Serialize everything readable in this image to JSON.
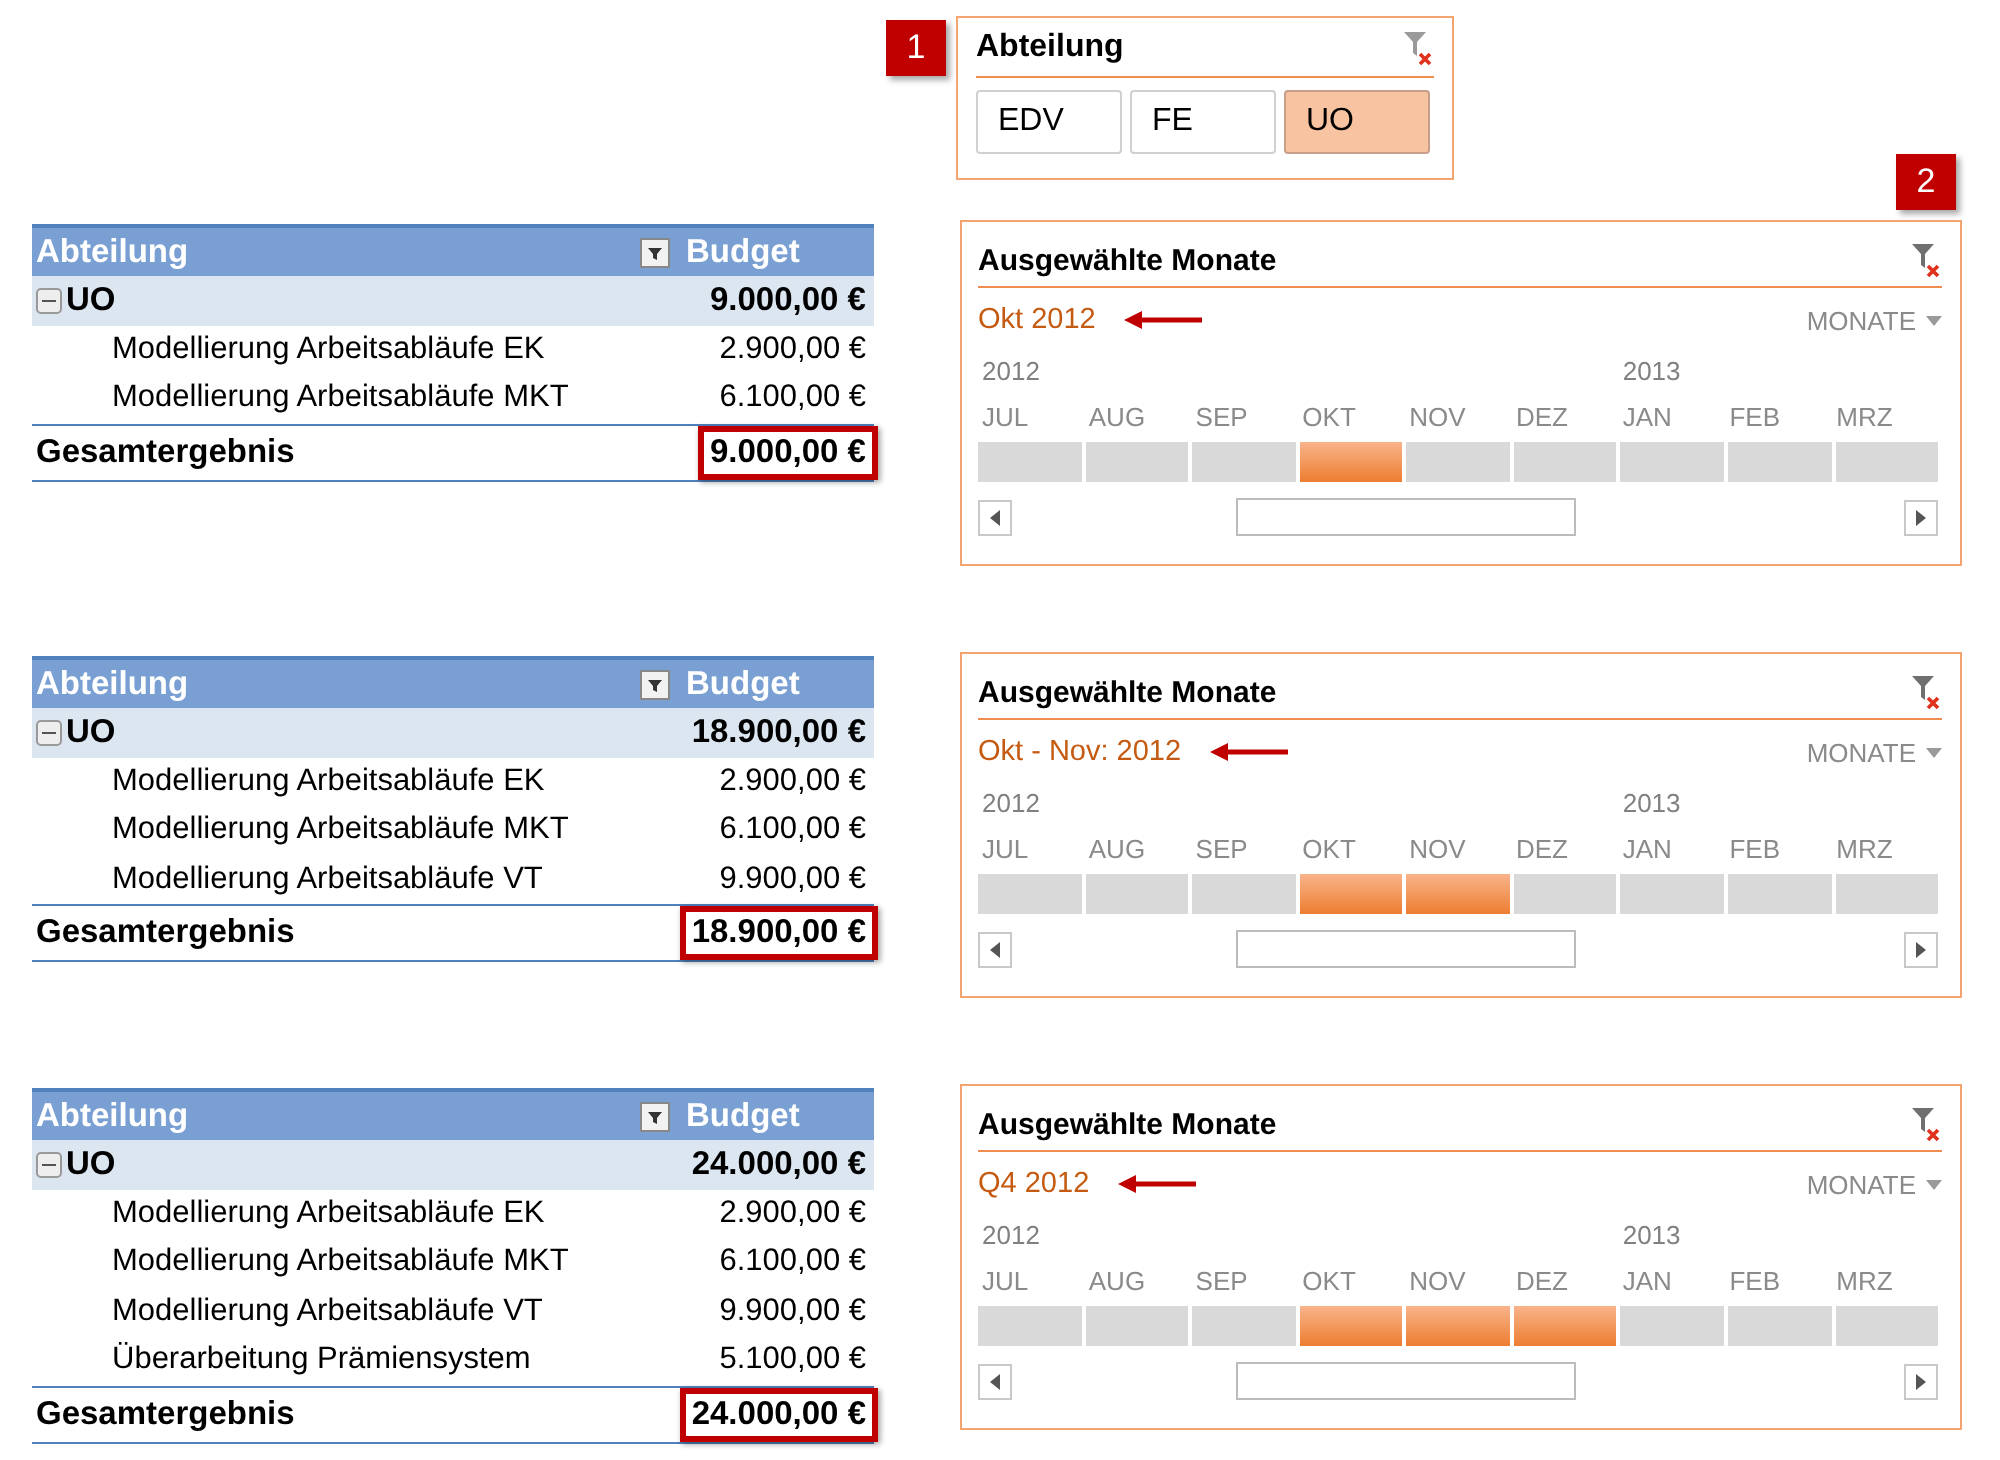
{
  "slicer": {
    "callout": "1",
    "title": "Abteilung",
    "items": [
      {
        "label": "EDV",
        "selected": false
      },
      {
        "label": "FE",
        "selected": false
      },
      {
        "label": "UO",
        "selected": true
      }
    ]
  },
  "panels": [
    {
      "pivot": {
        "columns": [
          "Abteilung",
          "Budget"
        ],
        "rows": [
          {
            "kind": "group",
            "label": "UO",
            "value": "9.000,00 €",
            "expanded": true
          },
          {
            "kind": "item",
            "label": "Modellierung Arbeitsabläufe EK",
            "value": "2.900,00 €"
          },
          {
            "kind": "item",
            "label": "Modellierung Arbeitsabläufe MKT",
            "value": "6.100,00 €"
          }
        ],
        "total": {
          "label": "Gesamtergebnis",
          "value": "9.000,00 €",
          "highlighted": true
        }
      },
      "timeline": {
        "callout": "2",
        "title": "Ausgewählte Monate",
        "selection": "Okt 2012",
        "level": "MONATE",
        "months": [
          {
            "label": "JUL",
            "year": "2012",
            "selected": false
          },
          {
            "label": "AUG",
            "selected": false
          },
          {
            "label": "SEP",
            "selected": false
          },
          {
            "label": "OKT",
            "selected": true
          },
          {
            "label": "NOV",
            "selected": false
          },
          {
            "label": "DEZ",
            "selected": false
          },
          {
            "label": "JAN",
            "year": "2013",
            "selected": false
          },
          {
            "label": "FEB",
            "selected": false
          },
          {
            "label": "MRZ",
            "selected": false
          }
        ]
      }
    },
    {
      "pivot": {
        "columns": [
          "Abteilung",
          "Budget"
        ],
        "rows": [
          {
            "kind": "group",
            "label": "UO",
            "value": "18.900,00 €",
            "expanded": true
          },
          {
            "kind": "item",
            "label": "Modellierung Arbeitsabläufe EK",
            "value": "2.900,00 €"
          },
          {
            "kind": "item",
            "label": "Modellierung Arbeitsabläufe MKT",
            "value": "6.100,00 €"
          },
          {
            "kind": "item",
            "label": "Modellierung Arbeitsabläufe VT",
            "value": "9.900,00 €"
          }
        ],
        "total": {
          "label": "Gesamtergebnis",
          "value": "18.900,00 €",
          "highlighted": true
        }
      },
      "timeline": {
        "title": "Ausgewählte Monate",
        "selection": "Okt - Nov: 2012",
        "level": "MONATE",
        "months": [
          {
            "label": "JUL",
            "year": "2012",
            "selected": false
          },
          {
            "label": "AUG",
            "selected": false
          },
          {
            "label": "SEP",
            "selected": false
          },
          {
            "label": "OKT",
            "selected": true
          },
          {
            "label": "NOV",
            "selected": true
          },
          {
            "label": "DEZ",
            "selected": false
          },
          {
            "label": "JAN",
            "year": "2013",
            "selected": false
          },
          {
            "label": "FEB",
            "selected": false
          },
          {
            "label": "MRZ",
            "selected": false
          }
        ]
      }
    },
    {
      "pivot": {
        "columns": [
          "Abteilung",
          "Budget"
        ],
        "rows": [
          {
            "kind": "group",
            "label": "UO",
            "value": "24.000,00 €",
            "expanded": true
          },
          {
            "kind": "item",
            "label": "Modellierung Arbeitsabläufe EK",
            "value": "2.900,00 €"
          },
          {
            "kind": "item",
            "label": "Modellierung Arbeitsabläufe MKT",
            "value": "6.100,00 €"
          },
          {
            "kind": "item",
            "label": "Modellierung Arbeitsabläufe VT",
            "value": "9.900,00 €"
          },
          {
            "kind": "item",
            "label": "Überarbeitung Prämiensystem",
            "value": "5.100,00 €"
          }
        ],
        "total": {
          "label": "Gesamtergebnis",
          "value": "24.000,00 €",
          "highlighted": true
        }
      },
      "timeline": {
        "title": "Ausgewählte Monate",
        "selection": "Q4 2012",
        "level": "MONATE",
        "months": [
          {
            "label": "JUL",
            "year": "2012",
            "selected": false
          },
          {
            "label": "AUG",
            "selected": false
          },
          {
            "label": "SEP",
            "selected": false
          },
          {
            "label": "OKT",
            "selected": true
          },
          {
            "label": "NOV",
            "selected": true
          },
          {
            "label": "DEZ",
            "selected": true
          },
          {
            "label": "JAN",
            "year": "2013",
            "selected": false
          },
          {
            "label": "FEB",
            "selected": false
          },
          {
            "label": "MRZ",
            "selected": false
          }
        ]
      }
    }
  ]
}
